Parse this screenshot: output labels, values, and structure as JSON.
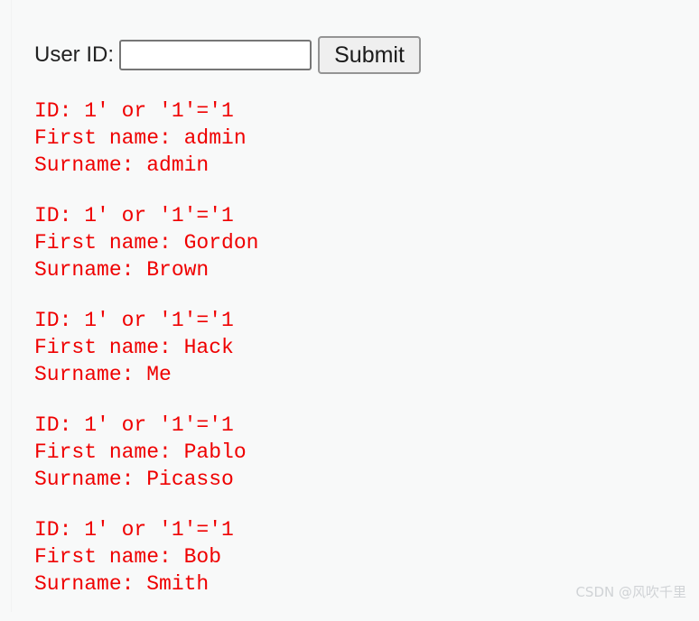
{
  "page": {
    "background_color": "#f8f9f9",
    "text_color_results": "#ef0000"
  },
  "form": {
    "label": "User ID:",
    "input": {
      "value": "",
      "placeholder": ""
    },
    "submit_label": "Submit"
  },
  "results": [
    {
      "id_line": "ID: 1' or '1'='1",
      "first_name_line": "First name: admin",
      "surname_line": "Surname: admin"
    },
    {
      "id_line": "ID: 1' or '1'='1",
      "first_name_line": "First name: Gordon",
      "surname_line": "Surname: Brown"
    },
    {
      "id_line": "ID: 1' or '1'='1",
      "first_name_line": "First name: Hack",
      "surname_line": "Surname: Me"
    },
    {
      "id_line": "ID: 1' or '1'='1",
      "first_name_line": "First name: Pablo",
      "surname_line": "Surname: Picasso"
    },
    {
      "id_line": "ID: 1' or '1'='1",
      "first_name_line": "First name: Bob",
      "surname_line": "Surname: Smith"
    }
  ],
  "watermark": {
    "text": "CSDN @风吹千里"
  }
}
